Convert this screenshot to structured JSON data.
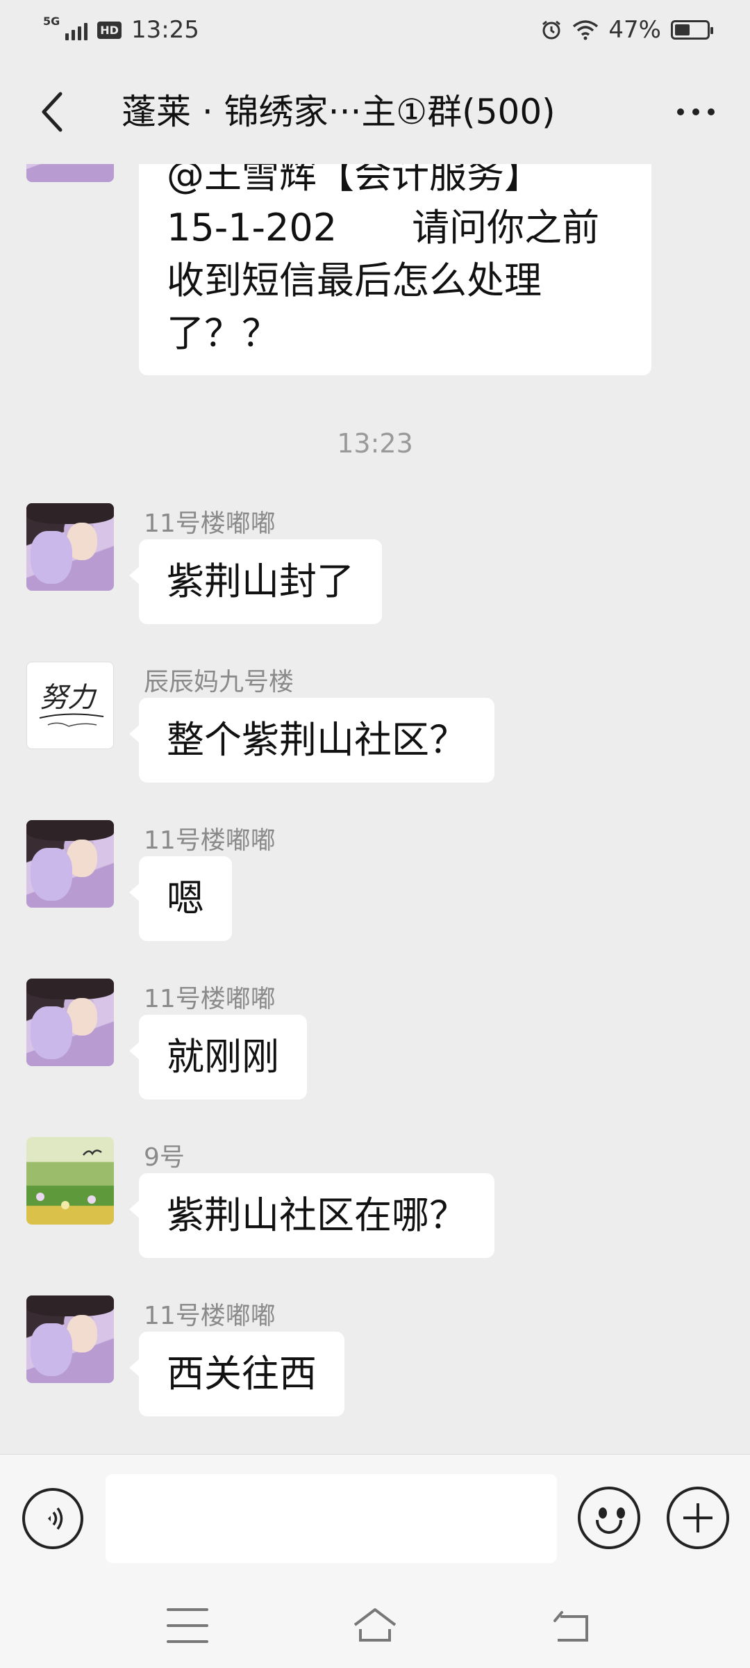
{
  "status_bar": {
    "network": "5G",
    "hd": "HD",
    "time": "13:25",
    "battery": "47%",
    "battery_level": 0.47
  },
  "header": {
    "title": "蓬莱 · 锦绣家···主①群(500)",
    "back_icon": "chevron-left-icon",
    "more_icon": "more-dots-icon"
  },
  "messages": {
    "prev": {
      "lines": [
        "@王雪辉【会计服务】",
        "15-1-202　　请问你之前",
        "收到短信最后怎么处理",
        "了？？"
      ]
    },
    "time_separator": "13:23",
    "list": [
      {
        "sender": "11号楼嘟嘟",
        "text": "紫荆山封了",
        "avatar": "girl-with-bunny"
      },
      {
        "sender": "辰辰妈九号楼",
        "text": "整个紫荆山社区？",
        "avatar": "calligraphy-signature",
        "avatar_text": "努力"
      },
      {
        "sender": "11号楼嘟嘟",
        "text": "嗯",
        "avatar": "girl-with-bunny"
      },
      {
        "sender": "11号楼嘟嘟",
        "text": "就刚刚",
        "avatar": "girl-with-bunny"
      },
      {
        "sender": "9号",
        "text": "紫荆山社区在哪？",
        "avatar": "flower-field-painting"
      },
      {
        "sender": "11号楼嘟嘟",
        "text": "西关往西",
        "avatar": "girl-with-bunny"
      }
    ]
  },
  "input_bar": {
    "voice_icon": "voice-icon",
    "input_value": "",
    "emoji_icon": "emoji-icon",
    "plus_icon": "plus-icon"
  },
  "nav_bar": {
    "menu_icon": "menu-icon",
    "home_icon": "home-icon",
    "back_icon": "back-icon"
  }
}
